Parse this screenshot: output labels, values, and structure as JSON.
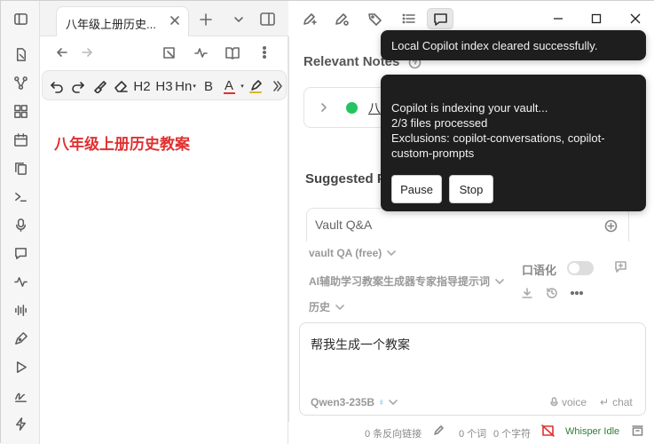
{
  "tab": {
    "title": "八年级上册历史..."
  },
  "editor": {
    "heading": "八年级上册历史教案",
    "heading_color": "#e03131",
    "toolbar": {
      "h2": "H2",
      "h3": "H3",
      "hn": "Hn",
      "bold": "B",
      "font_color": "A"
    }
  },
  "copilot": {
    "relevant_notes_title": "Relevant Notes",
    "relevant_note_item": "八",
    "suggested_title": "Suggested P",
    "vault_card_title": "Vault Q&A",
    "mode_selector": "vault QA (free)",
    "prompt_selector": "AI辅助学习教案生成器专家指导提示词",
    "history_selector": "历史",
    "colloquial_label": "口语化",
    "input_value": "帮我生成一个教案",
    "model": "Qwen3-235B",
    "voice_label": "voice",
    "chat_label": "chat"
  },
  "notices": {
    "cleared": "Local Copilot index cleared successfully.",
    "indexing_line1": "Copilot is indexing your vault...",
    "indexing_line2": "2/3 files processed",
    "indexing_line3": "Exclusions: copilot-conversations, copilot-custom-prompts",
    "pause_label": "Pause",
    "stop_label": "Stop"
  },
  "statusbar": {
    "backlinks": "0 条反向链接",
    "words": "0 个词",
    "chars": "0 个字符",
    "whisper": "Whisper Idle",
    "whisper_color": "#2f7d32"
  }
}
